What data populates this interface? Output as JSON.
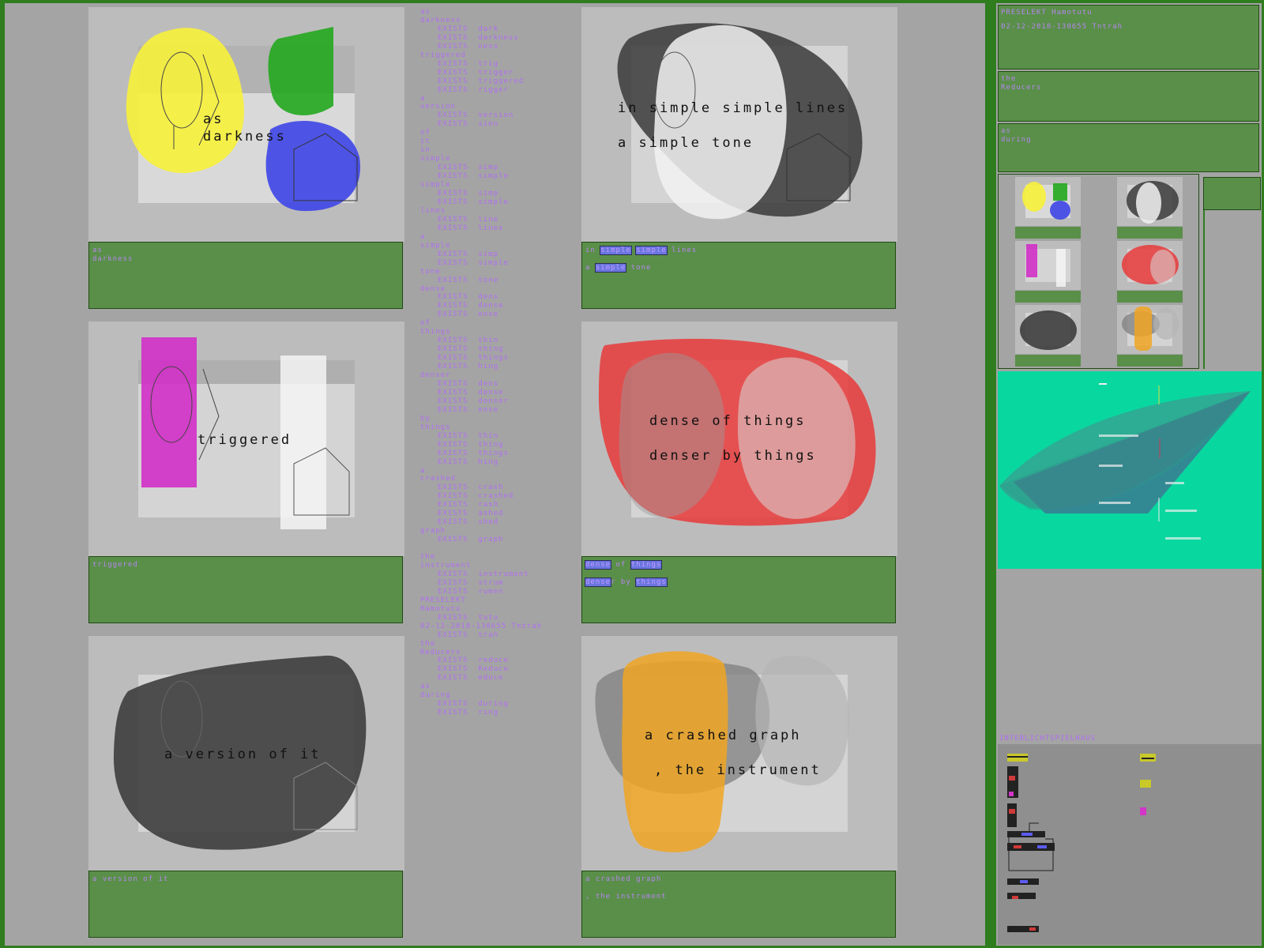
{
  "panels": [
    {
      "id": "p1",
      "canvas_lines": [
        "as",
        "darkness"
      ],
      "caption_lines": [
        {
          "text": "as",
          "tight": true
        },
        {
          "text": "darkness",
          "tight": true
        }
      ],
      "shape_colors": [
        "#f7f13a",
        "#22a71e",
        "#3d45e6"
      ]
    },
    {
      "id": "p2",
      "canvas_lines": [
        "in simple simple lines",
        "a simple tone"
      ],
      "caption_lines": [
        {
          "parts": [
            {
              "t": "in "
            },
            {
              "t": "simple",
              "hl": true
            },
            {
              "t": " "
            },
            {
              "t": "simple",
              "hl": true
            },
            {
              "t": " lines"
            }
          ]
        },
        {
          "parts": [
            {
              "t": "a "
            },
            {
              "t": "simple",
              "hl": true
            },
            {
              "t": " tone"
            }
          ]
        }
      ],
      "shape_colors": [
        "#3a3a3a",
        "#f2f2f2"
      ]
    },
    {
      "id": "p3",
      "canvas_lines": [
        "triggered"
      ],
      "caption_lines": [
        {
          "text": "triggered"
        }
      ],
      "shape_colors": [
        "#d22fc7",
        "#f5f5f5"
      ]
    },
    {
      "id": "p4",
      "canvas_lines": [
        "dense of things",
        "denser by things"
      ],
      "caption_lines": [
        {
          "parts": [
            {
              "t": "dense",
              "hl": true
            },
            {
              "t": " of "
            },
            {
              "t": "things",
              "hl": true
            }
          ]
        },
        {
          "parts": [
            {
              "t": "dense",
              "hl": true
            },
            {
              "t": "r by "
            },
            {
              "t": "things",
              "hl": true
            }
          ]
        }
      ],
      "shape_colors": [
        "#e83a3a",
        "#d9d9d9"
      ]
    },
    {
      "id": "p5",
      "canvas_lines": [
        "a version of it"
      ],
      "caption_lines": [
        {
          "text": "a version of it"
        }
      ],
      "shape_colors": [
        "#3a3a3a"
      ]
    },
    {
      "id": "p6",
      "canvas_lines": [
        "a crashed graph",
        ", the instrument"
      ],
      "caption_lines": [
        {
          "text": "a crashed graph"
        },
        {
          "text": " , the instrument"
        }
      ],
      "shape_colors": [
        "#f0a623",
        "#7a7a7a"
      ]
    }
  ],
  "wordlist": [
    [
      "as",
      0
    ],
    [
      "darkness",
      0
    ],
    [
      "EXISTS  dark",
      1
    ],
    [
      "EXISTS  darkness",
      1
    ],
    [
      "EXISTS  ness",
      1
    ],
    [
      "triggered",
      0
    ],
    [
      "EXISTS  trig",
      1
    ],
    [
      "EXISTS  trigger",
      1
    ],
    [
      "EXISTS  triggered",
      1
    ],
    [
      "EXISTS  rigger",
      1
    ],
    [
      "a",
      0
    ],
    [
      "version",
      0
    ],
    [
      "EXISTS  version",
      1
    ],
    [
      "EXISTS  sion",
      1
    ],
    [
      "of",
      0
    ],
    [
      "it",
      0
    ],
    [
      "in",
      0
    ],
    [
      "simple",
      0
    ],
    [
      "EXISTS  simp",
      1
    ],
    [
      "EXISTS  simple",
      1
    ],
    [
      "simple",
      0
    ],
    [
      "EXISTS  simp",
      1
    ],
    [
      "EXISTS  simple",
      1
    ],
    [
      "lines",
      0
    ],
    [
      "EXISTS  line",
      1
    ],
    [
      "EXISTS  lines",
      1
    ],
    [
      "a",
      0
    ],
    [
      "simple",
      0
    ],
    [
      "EXISTS  simp",
      1
    ],
    [
      "EXISTS  simple",
      1
    ],
    [
      "tone",
      0
    ],
    [
      "EXISTS  tone",
      1
    ],
    [
      "dense",
      0
    ],
    [
      "EXISTS  dens",
      1
    ],
    [
      "EXISTS  dense",
      1
    ],
    [
      "EXISTS  ense",
      1
    ],
    [
      "of",
      0
    ],
    [
      "things",
      0
    ],
    [
      "EXISTS  thin",
      1
    ],
    [
      "EXISTS  thing",
      1
    ],
    [
      "EXISTS  things",
      1
    ],
    [
      "EXISTS  hing",
      1
    ],
    [
      "denser",
      0
    ],
    [
      "EXISTS  dens",
      1
    ],
    [
      "EXISTS  dense",
      1
    ],
    [
      "EXISTS  denser",
      1
    ],
    [
      "EXISTS  ense",
      1
    ],
    [
      "by",
      0
    ],
    [
      "things",
      0
    ],
    [
      "EXISTS  thin",
      1
    ],
    [
      "EXISTS  thing",
      1
    ],
    [
      "EXISTS  things",
      1
    ],
    [
      "EXISTS  hing",
      1
    ],
    [
      "a",
      0
    ],
    [
      "crashed",
      0
    ],
    [
      "EXISTS  crash",
      1
    ],
    [
      "EXISTS  crashed",
      1
    ],
    [
      "EXISTS  rash",
      1
    ],
    [
      "EXISTS  ashed",
      1
    ],
    [
      "EXISTS  shed",
      1
    ],
    [
      "graph",
      0
    ],
    [
      "EXISTS  graph",
      1
    ],
    [
      "",
      0
    ],
    [
      "the",
      0
    ],
    [
      "instrument",
      0
    ],
    [
      "EXISTS  instrument",
      1
    ],
    [
      "EXISTS  strum",
      1
    ],
    [
      "EXISTS  rumen",
      1
    ],
    [
      "PRESELEKT",
      0
    ],
    [
      "Hamotutu",
      0
    ],
    [
      "EXISTS  tutu",
      1
    ],
    [
      "02-12-2018-130655 Tntrah",
      0
    ],
    [
      "EXISTS  trah",
      1
    ],
    [
      "the",
      0
    ],
    [
      "Reducers",
      0
    ],
    [
      "EXISTS  reduce",
      1
    ],
    [
      "EXISTS  Reduce",
      1
    ],
    [
      "EXISTS  educe",
      1
    ],
    [
      "as",
      0
    ],
    [
      "during",
      0
    ],
    [
      "EXISTS  during",
      1
    ],
    [
      "EXISTS  ring",
      1
    ]
  ],
  "sidebar": {
    "header_line1": "PRESELEKT Hamotutu",
    "header_line2": "02-12-2018-130655 Tntrah",
    "box2_line1": "the",
    "box2_line2": "Reducers",
    "box3_line1": "as",
    "box3_line2": "during",
    "inter_label": "INTERLICHTSPIELHAUS"
  },
  "colors": {
    "frame_green": "#2f7d1e",
    "caption_green": "#5a8f49",
    "text_violet": "#b06ff0",
    "graph_teal": "#08d8a0",
    "highlight_blue": "#6a76e0"
  }
}
